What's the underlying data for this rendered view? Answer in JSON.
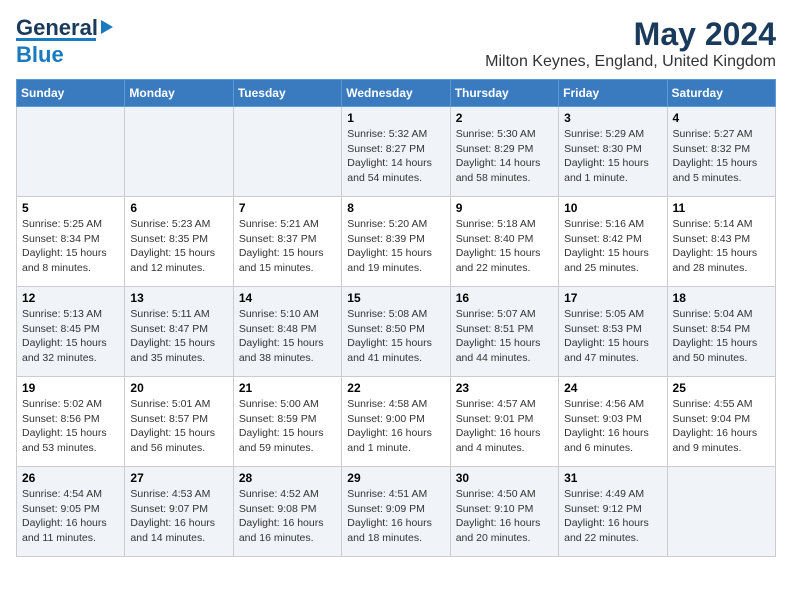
{
  "header": {
    "logo_line1": "General",
    "logo_line2": "Blue",
    "main_title": "May 2024",
    "subtitle": "Milton Keynes, England, United Kingdom"
  },
  "days_of_week": [
    "Sunday",
    "Monday",
    "Tuesday",
    "Wednesday",
    "Thursday",
    "Friday",
    "Saturday"
  ],
  "weeks": [
    [
      {
        "day": "",
        "info": ""
      },
      {
        "day": "",
        "info": ""
      },
      {
        "day": "",
        "info": ""
      },
      {
        "day": "1",
        "info": "Sunrise: 5:32 AM\nSunset: 8:27 PM\nDaylight: 14 hours\nand 54 minutes."
      },
      {
        "day": "2",
        "info": "Sunrise: 5:30 AM\nSunset: 8:29 PM\nDaylight: 14 hours\nand 58 minutes."
      },
      {
        "day": "3",
        "info": "Sunrise: 5:29 AM\nSunset: 8:30 PM\nDaylight: 15 hours\nand 1 minute."
      },
      {
        "day": "4",
        "info": "Sunrise: 5:27 AM\nSunset: 8:32 PM\nDaylight: 15 hours\nand 5 minutes."
      }
    ],
    [
      {
        "day": "5",
        "info": "Sunrise: 5:25 AM\nSunset: 8:34 PM\nDaylight: 15 hours\nand 8 minutes."
      },
      {
        "day": "6",
        "info": "Sunrise: 5:23 AM\nSunset: 8:35 PM\nDaylight: 15 hours\nand 12 minutes."
      },
      {
        "day": "7",
        "info": "Sunrise: 5:21 AM\nSunset: 8:37 PM\nDaylight: 15 hours\nand 15 minutes."
      },
      {
        "day": "8",
        "info": "Sunrise: 5:20 AM\nSunset: 8:39 PM\nDaylight: 15 hours\nand 19 minutes."
      },
      {
        "day": "9",
        "info": "Sunrise: 5:18 AM\nSunset: 8:40 PM\nDaylight: 15 hours\nand 22 minutes."
      },
      {
        "day": "10",
        "info": "Sunrise: 5:16 AM\nSunset: 8:42 PM\nDaylight: 15 hours\nand 25 minutes."
      },
      {
        "day": "11",
        "info": "Sunrise: 5:14 AM\nSunset: 8:43 PM\nDaylight: 15 hours\nand 28 minutes."
      }
    ],
    [
      {
        "day": "12",
        "info": "Sunrise: 5:13 AM\nSunset: 8:45 PM\nDaylight: 15 hours\nand 32 minutes."
      },
      {
        "day": "13",
        "info": "Sunrise: 5:11 AM\nSunset: 8:47 PM\nDaylight: 15 hours\nand 35 minutes."
      },
      {
        "day": "14",
        "info": "Sunrise: 5:10 AM\nSunset: 8:48 PM\nDaylight: 15 hours\nand 38 minutes."
      },
      {
        "day": "15",
        "info": "Sunrise: 5:08 AM\nSunset: 8:50 PM\nDaylight: 15 hours\nand 41 minutes."
      },
      {
        "day": "16",
        "info": "Sunrise: 5:07 AM\nSunset: 8:51 PM\nDaylight: 15 hours\nand 44 minutes."
      },
      {
        "day": "17",
        "info": "Sunrise: 5:05 AM\nSunset: 8:53 PM\nDaylight: 15 hours\nand 47 minutes."
      },
      {
        "day": "18",
        "info": "Sunrise: 5:04 AM\nSunset: 8:54 PM\nDaylight: 15 hours\nand 50 minutes."
      }
    ],
    [
      {
        "day": "19",
        "info": "Sunrise: 5:02 AM\nSunset: 8:56 PM\nDaylight: 15 hours\nand 53 minutes."
      },
      {
        "day": "20",
        "info": "Sunrise: 5:01 AM\nSunset: 8:57 PM\nDaylight: 15 hours\nand 56 minutes."
      },
      {
        "day": "21",
        "info": "Sunrise: 5:00 AM\nSunset: 8:59 PM\nDaylight: 15 hours\nand 59 minutes."
      },
      {
        "day": "22",
        "info": "Sunrise: 4:58 AM\nSunset: 9:00 PM\nDaylight: 16 hours\nand 1 minute."
      },
      {
        "day": "23",
        "info": "Sunrise: 4:57 AM\nSunset: 9:01 PM\nDaylight: 16 hours\nand 4 minutes."
      },
      {
        "day": "24",
        "info": "Sunrise: 4:56 AM\nSunset: 9:03 PM\nDaylight: 16 hours\nand 6 minutes."
      },
      {
        "day": "25",
        "info": "Sunrise: 4:55 AM\nSunset: 9:04 PM\nDaylight: 16 hours\nand 9 minutes."
      }
    ],
    [
      {
        "day": "26",
        "info": "Sunrise: 4:54 AM\nSunset: 9:05 PM\nDaylight: 16 hours\nand 11 minutes."
      },
      {
        "day": "27",
        "info": "Sunrise: 4:53 AM\nSunset: 9:07 PM\nDaylight: 16 hours\nand 14 minutes."
      },
      {
        "day": "28",
        "info": "Sunrise: 4:52 AM\nSunset: 9:08 PM\nDaylight: 16 hours\nand 16 minutes."
      },
      {
        "day": "29",
        "info": "Sunrise: 4:51 AM\nSunset: 9:09 PM\nDaylight: 16 hours\nand 18 minutes."
      },
      {
        "day": "30",
        "info": "Sunrise: 4:50 AM\nSunset: 9:10 PM\nDaylight: 16 hours\nand 20 minutes."
      },
      {
        "day": "31",
        "info": "Sunrise: 4:49 AM\nSunset: 9:12 PM\nDaylight: 16 hours\nand 22 minutes."
      },
      {
        "day": "",
        "info": ""
      }
    ]
  ]
}
